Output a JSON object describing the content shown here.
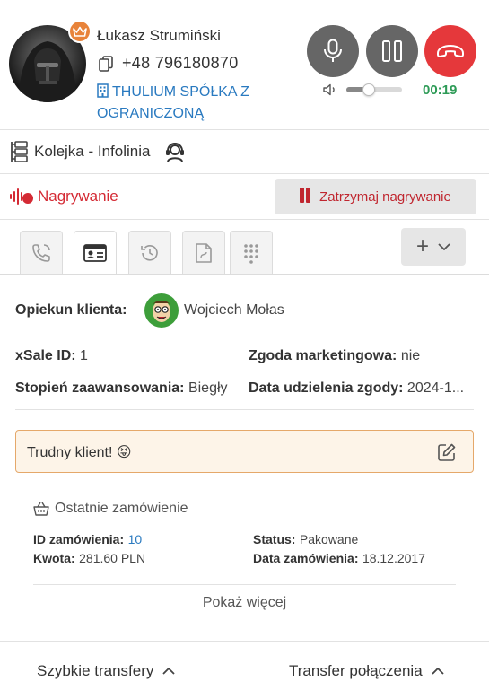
{
  "contact": {
    "name": "Łukasz Strumiński",
    "phone": "+48 796180870",
    "company": "THULIUM SPÓŁKA Z OGRANICZONĄ",
    "vip_icon": "crown-icon"
  },
  "call": {
    "timer": "00:19",
    "volume_level": 0.4,
    "colors": {
      "control": "#666666",
      "hangup": "#e5383b",
      "timer": "#2e9b57"
    }
  },
  "queue": {
    "label": "Kolejka - Infolinia"
  },
  "recording": {
    "label": "Nagrywanie",
    "stop_label": "Zatrzymaj nagrywanie",
    "color": "#d42a34"
  },
  "tabs": [
    {
      "icon": "phone-history-icon",
      "active": false
    },
    {
      "icon": "contact-card-icon",
      "active": true
    },
    {
      "icon": "history-icon",
      "active": false
    },
    {
      "icon": "document-icon",
      "active": false
    },
    {
      "icon": "dialpad-icon",
      "active": false
    }
  ],
  "tab_add": {
    "label": "+"
  },
  "customer": {
    "caretaker_label": "Opiekun klienta:",
    "caretaker_name": "Wojciech Mołas",
    "fields": {
      "xsale_label": "xSale ID:",
      "xsale_value": "1",
      "consent_label": "Zgoda marketingowa:",
      "consent_value": "nie",
      "level_label": "Stopień zaawansowania:",
      "level_value": "Biegły",
      "consent_date_label": "Data udzielenia zgody:",
      "consent_date_value": "2024-1..."
    }
  },
  "note": {
    "text": "Trudny klient! 😝"
  },
  "last_order": {
    "title": "Ostatnie zamówienie",
    "id_label": "ID zamówienia:",
    "id_value": "10",
    "amount_label": "Kwota:",
    "amount_value": "281.60 PLN",
    "status_label": "Status:",
    "status_value": "Pakowane",
    "date_label": "Data zamówienia:",
    "date_value": "18.12.2017",
    "show_more": "Pokaż więcej"
  },
  "footer": {
    "quick_transfers": "Szybkie transfery",
    "call_transfer": "Transfer połączenia"
  }
}
